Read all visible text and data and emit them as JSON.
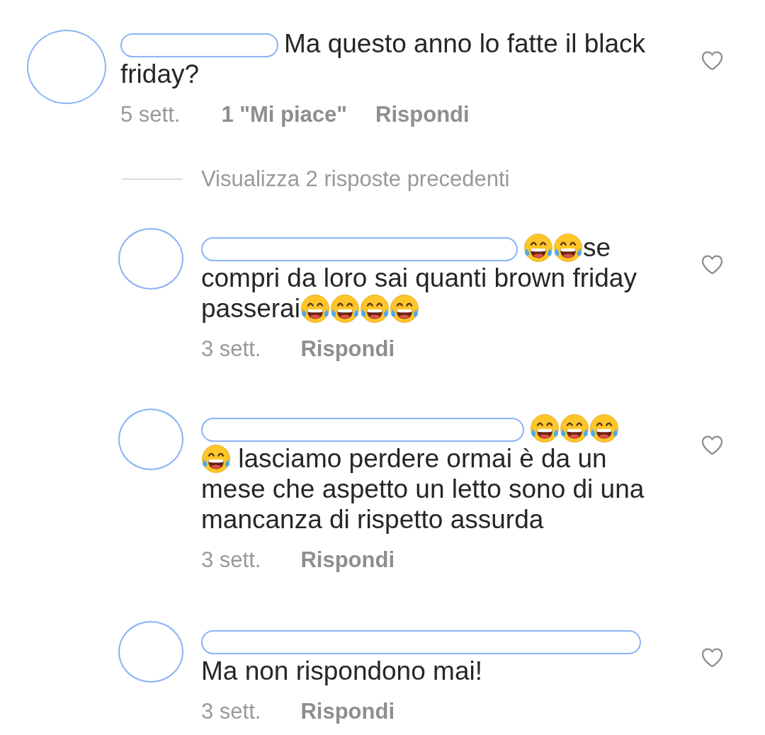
{
  "comment": {
    "lines": [
      [
        {
          "kind": "redacted_name"
        },
        {
          "kind": "text",
          "text": "Ma questo anno lo fatte il black"
        }
      ],
      [
        {
          "kind": "text",
          "text": "friday?"
        }
      ]
    ],
    "time": "5 sett.",
    "likes": "1 \"Mi piace\"",
    "reply_label": "Rispondi",
    "liked": false
  },
  "view_replies": "Visualizza 2 risposte precedenti",
  "replies": [
    {
      "lines": [
        [
          {
            "kind": "redacted_name"
          },
          {
            "kind": "emoji"
          },
          {
            "kind": "emoji"
          },
          {
            "kind": "text",
            "text": "se"
          }
        ],
        [
          {
            "kind": "text",
            "text": "compri da loro sai quanti brown friday"
          }
        ],
        [
          {
            "kind": "text",
            "text": "passerai"
          },
          {
            "kind": "emoji"
          },
          {
            "kind": "emoji"
          },
          {
            "kind": "emoji"
          },
          {
            "kind": "emoji"
          }
        ]
      ],
      "time": "3 sett.",
      "reply_label": "Rispondi",
      "liked": false
    },
    {
      "lines": [
        [
          {
            "kind": "redacted_name"
          },
          {
            "kind": "emoji"
          },
          {
            "kind": "emoji"
          },
          {
            "kind": "emoji"
          }
        ],
        [
          {
            "kind": "emoji"
          },
          {
            "kind": "text",
            "text": " lasciamo perdere ormai è da un"
          }
        ],
        [
          {
            "kind": "text",
            "text": "mese che aspetto un letto sono di una"
          }
        ],
        [
          {
            "kind": "text",
            "text": "mancanza di rispetto assurda"
          }
        ]
      ],
      "time": "3 sett.",
      "reply_label": "Rispondi",
      "liked": false
    },
    {
      "lines": [
        [
          {
            "kind": "redacted_name"
          }
        ],
        [
          {
            "kind": "text",
            "text": "Ma non rispondono mai!"
          }
        ]
      ],
      "time": "3 sett.",
      "reply_label": "Rispondi",
      "liked": false
    }
  ]
}
